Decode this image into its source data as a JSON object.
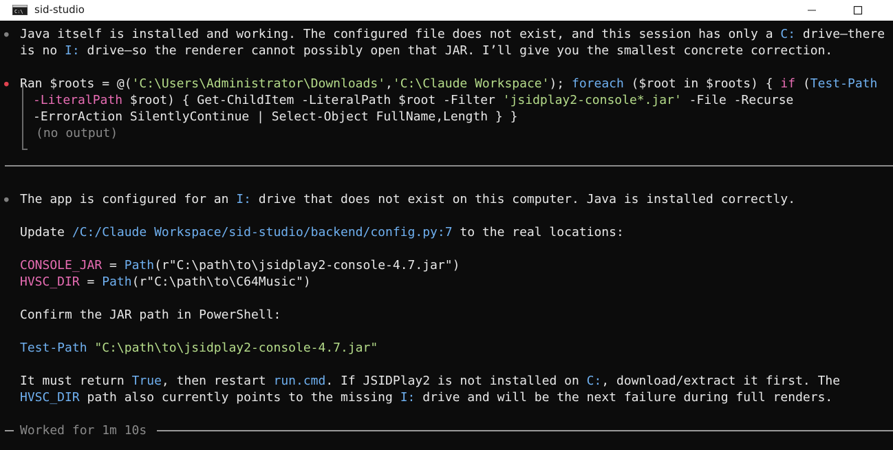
{
  "window": {
    "title": "sid-studio",
    "icon": "terminal-icon",
    "controls": [
      "minimize-icon",
      "maximize-icon"
    ]
  },
  "colors": {
    "background": "#0c0c0c",
    "text": "#e8e8e8",
    "accent_blue": "#6fb0f0",
    "string_green": "#b5dc8a",
    "keyword_pink": "#e86db4",
    "bullet_red": "#e0424f"
  },
  "session": {
    "p1_l1_a": "Java itself is installed and working. The configured file does not exist, and this session has only a ",
    "drive_c": "C:",
    "p1_l1_b": " drive—there",
    "p1_l2_a": "is no ",
    "drive_i": "I:",
    "p1_l2_b": " drive—so the renderer cannot possibly open that JAR. I’ll give you the smallest concrete correction.",
    "cmd": {
      "ran": "Ran ",
      "l1_a": "$roots = @(",
      "l1_s1": "'C:\\Users\\Administrator\\Downloads'",
      "l1_comma": ",",
      "l1_s2": "'C:\\Claude Workspace'",
      "l1_b": "); ",
      "kw_foreach": "foreach",
      "l1_c": " ($root in $roots) { ",
      "kw_if": "if",
      "l1_d": " (",
      "l1_testpath": "Test-Path",
      "l2_param": "-LiteralPath",
      "l2_a": " $root) { Get-ChildItem -LiteralPath $root -Filter ",
      "l2_str": "'jsidplay2-console*.jar'",
      "l2_b": " -File -Recurse",
      "l3": "-ErrorAction SilentlyContinue | Select-Object FullName,Length } }",
      "output": "(no output)"
    },
    "p2_a": "The app is configured for an ",
    "p2_b": " drive that does not exist on this computer. Java is installed correctly.",
    "p3_a": "Update ",
    "config_link": "/C:/Claude Workspace/sid-studio/backend/config.py:7",
    "p3_b": " to the real locations:",
    "code1_var": "CONSOLE_JAR",
    "code1_eq": " = ",
    "code1_fn": "Path",
    "code1_arg": "(r\"C:\\path\\to\\jsidplay2-console-4.7.jar\")",
    "code2_var": "HVSC_DIR",
    "code2_eq": " = ",
    "code2_fn": "Path",
    "code2_arg": "(r\"C:\\path\\to\\C64Music\")",
    "p4": "Confirm the JAR path in PowerShell:",
    "tp_cmd": "Test-Path",
    "tp_sp": " ",
    "tp_arg": "\"C:\\path\\to\\jsidplay2-console-4.7.jar\"",
    "p5_a": "It must return ",
    "true_word": "True",
    "p5_b": ", then restart ",
    "run_cmd": "run.cmd",
    "p5_c": ". If JSIDPlay2 is not installed on ",
    "p5_d": ", download/extract it first. The",
    "hvsc": "HVSC_DIR",
    "p6_a": " path also currently points to the missing ",
    "p6_b": " drive and will be the next failure during full renders.",
    "footer": "Worked for 1m 10s"
  }
}
